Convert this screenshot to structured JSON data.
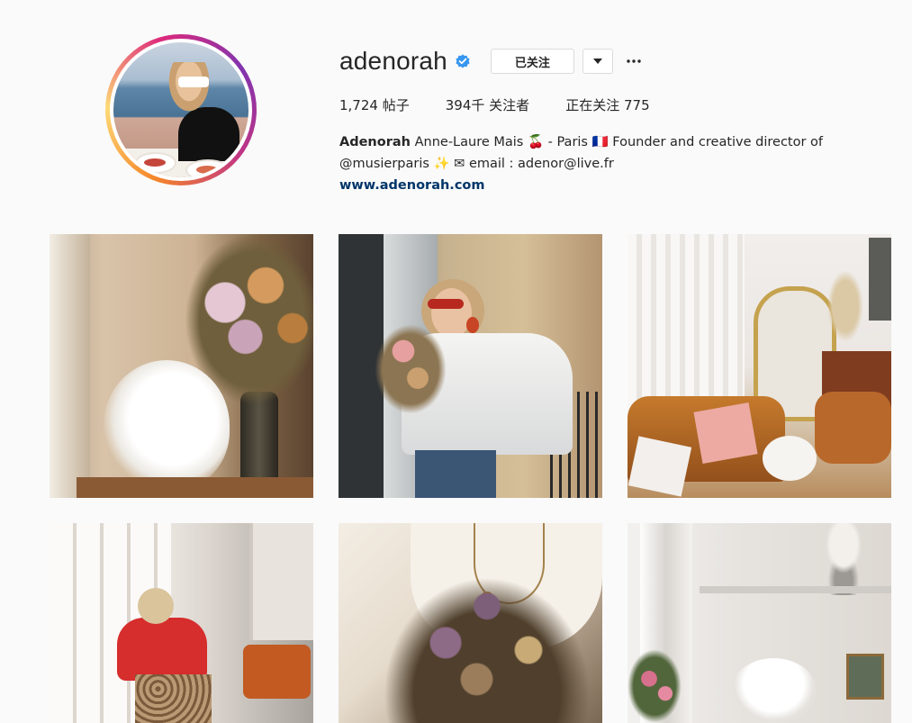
{
  "profile": {
    "username": "adenorah",
    "follow_button_label": "已关注",
    "stats": {
      "posts_count": "1,724",
      "posts_label": "帖子",
      "followers_count": "394千",
      "followers_label": "关注者",
      "following_label": "正在关注",
      "following_count": "775"
    },
    "bio": {
      "display_name": "Adenorah",
      "line1_rest": " Anne-Laure Mais 🍒 - Paris 🇫🇷 Founder and creative director of",
      "line2": "@musierparis ✨ ✉ email : adenor@live.fr",
      "website": "www.adenorah.com"
    }
  },
  "icons": {
    "verified": "verified-badge-icon",
    "dropdown": "caret-down-icon",
    "more": "ellipsis-icon"
  },
  "colors": {
    "verified_blue": "#3897f0",
    "link": "#003569",
    "border": "#dbdbdb"
  }
}
